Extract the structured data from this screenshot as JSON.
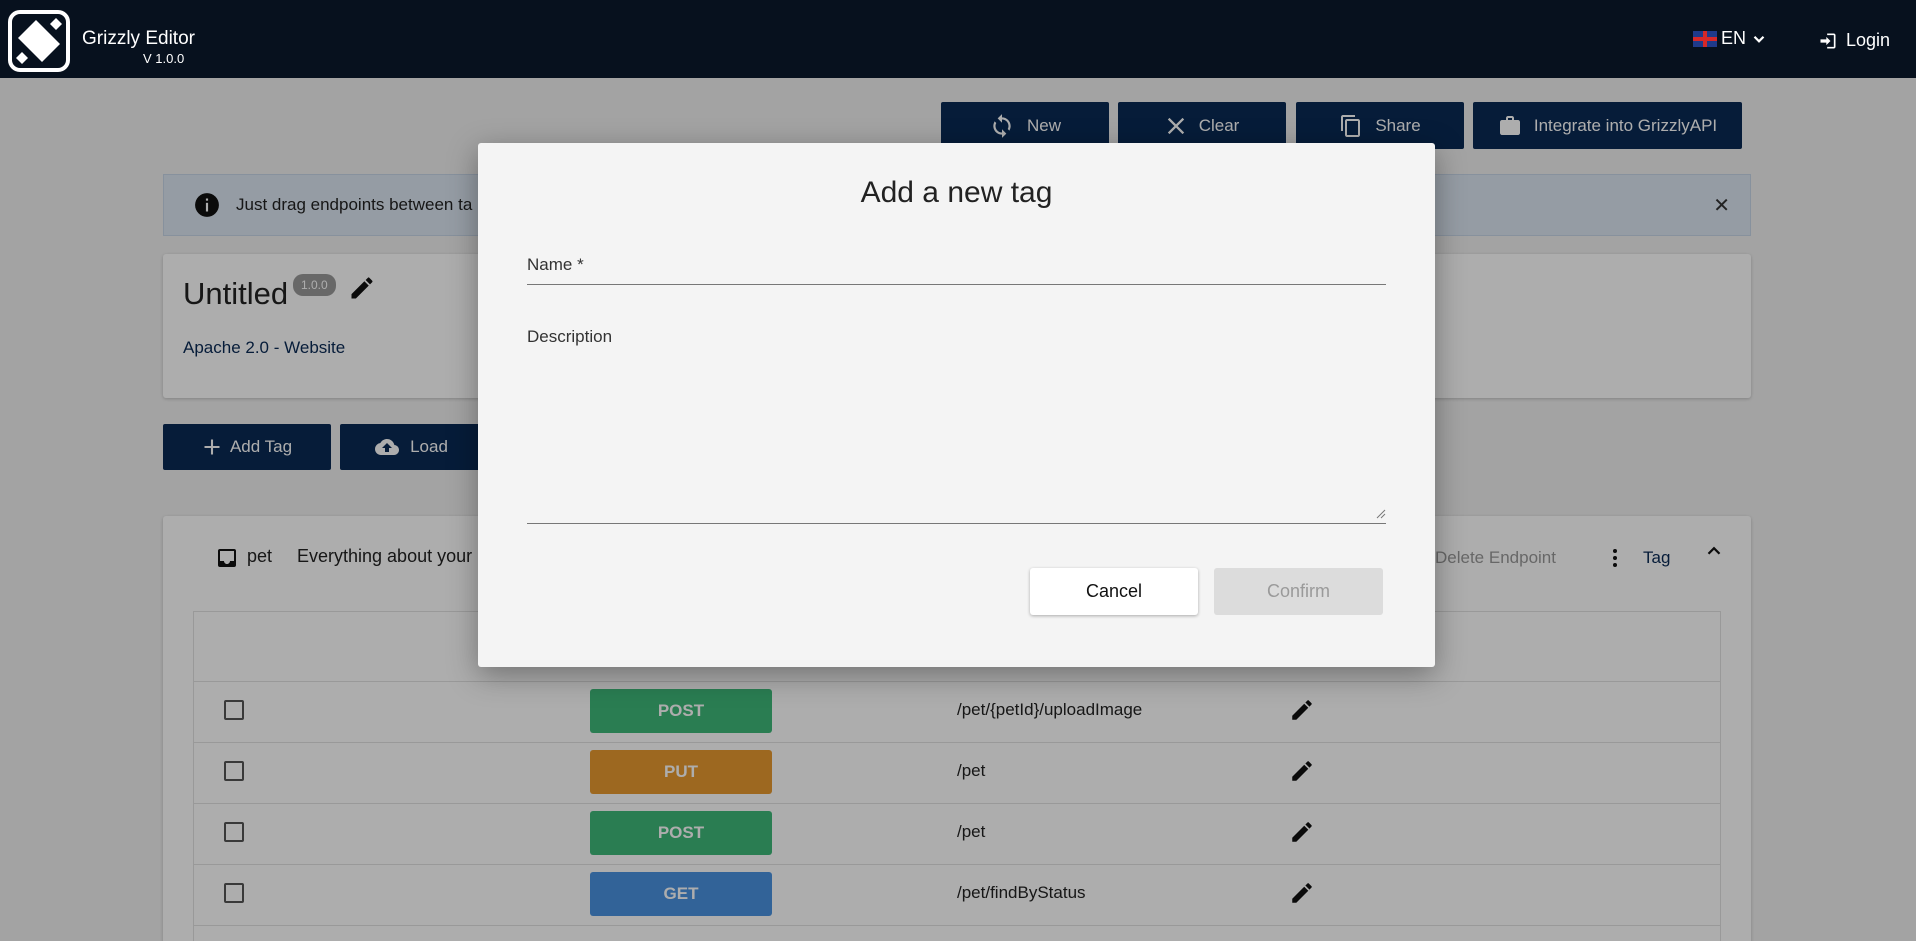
{
  "header": {
    "app_title": "Grizzly Editor",
    "version": "V 1.0.0",
    "language": "EN",
    "login_label": "Login",
    "logo_icon": "grizzly-logo"
  },
  "toolbar": {
    "new_label": "New",
    "clear_label": "Clear",
    "share_label": "Share",
    "integrate_label": "Integrate into GrizzlyAPI"
  },
  "banner": {
    "text": "Just drag endpoints between ta"
  },
  "api": {
    "title": "Untitled",
    "version_badge": "1.0.0",
    "license": "Apache 2.0 - Website"
  },
  "actions": {
    "add_tag_label": "Add Tag",
    "load_label": "Load"
  },
  "tag": {
    "name": "pet",
    "description": "Everything about your",
    "delete_endpoint_label": "Delete Endpoint",
    "tag_label": "Tag"
  },
  "endpoints": [
    {
      "method": "POST",
      "path": "/pet/{petId}/uploadImage",
      "color": "#3fb87a"
    },
    {
      "method": "PUT",
      "path": "/pet",
      "color": "#e89a30"
    },
    {
      "method": "POST",
      "path": "/pet",
      "color": "#3fb87a"
    },
    {
      "method": "GET",
      "path": "/pet/findByStatus",
      "color": "#4b93e0"
    }
  ],
  "dialog": {
    "title": "Add a new tag",
    "name_label": "Name *",
    "description_label": "Description",
    "cancel_label": "Cancel",
    "confirm_label": "Confirm"
  },
  "colors": {
    "header_bg": "#07111e",
    "primary": "#0a2a55"
  }
}
